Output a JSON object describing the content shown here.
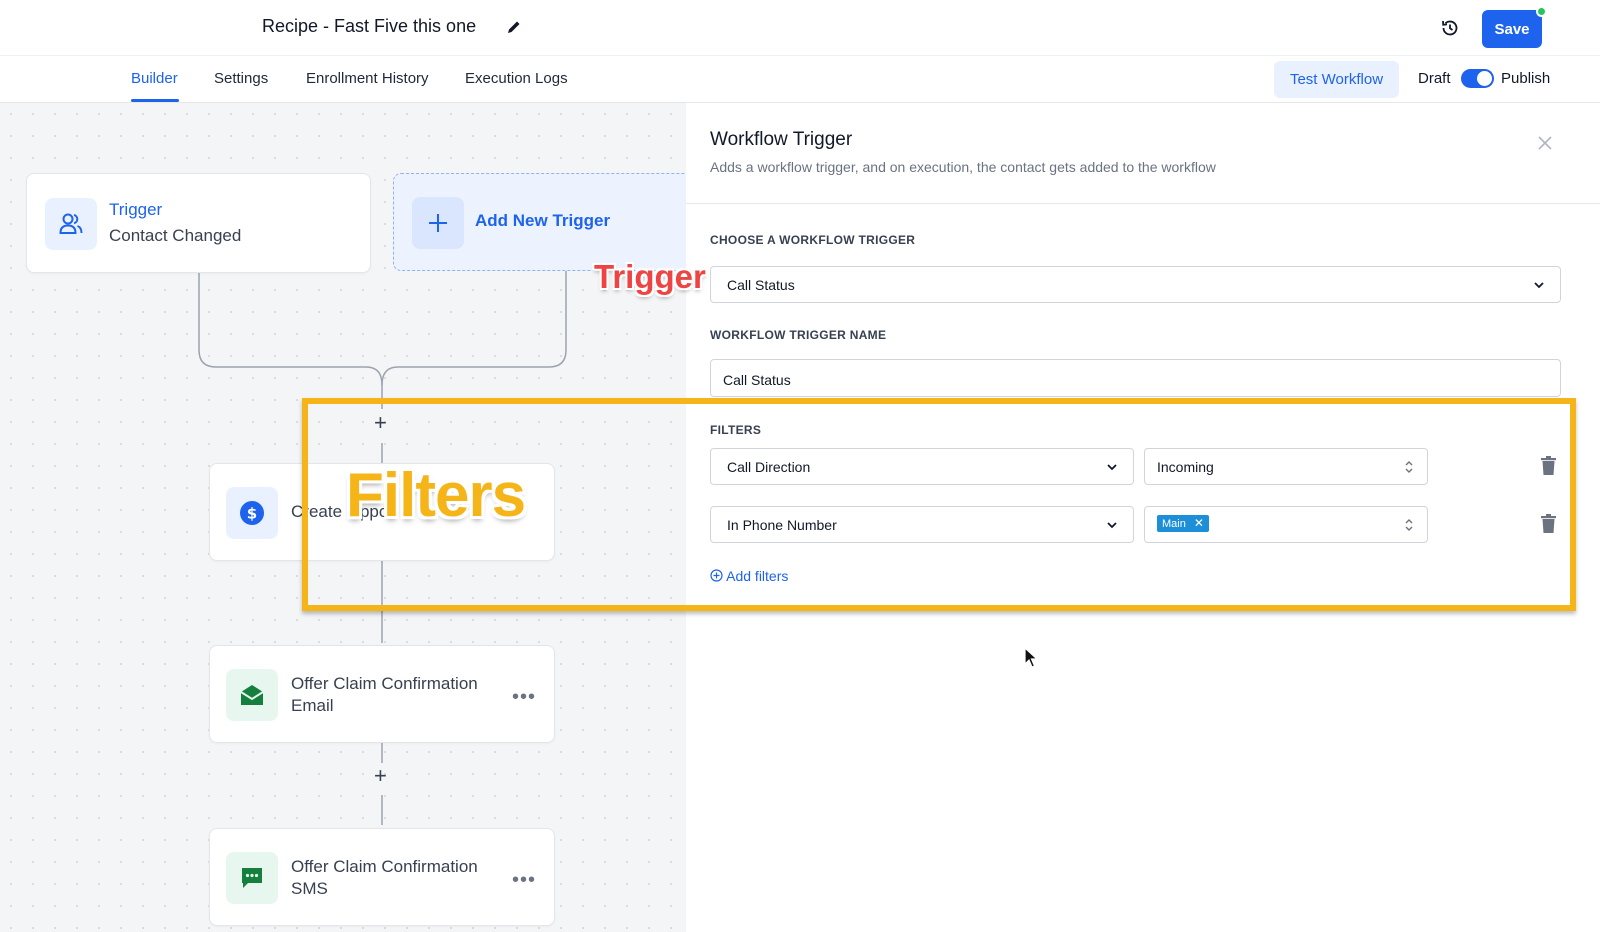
{
  "header": {
    "title": "Recipe - Fast Five this one",
    "save_label": "Save"
  },
  "tabs": [
    {
      "label": "Builder",
      "active": true
    },
    {
      "label": "Settings"
    },
    {
      "label": "Enrollment History"
    },
    {
      "label": "Execution Logs"
    }
  ],
  "toolbar": {
    "test_workflow": "Test Workflow",
    "draft": "Draft",
    "publish": "Publish",
    "published_toggle": true
  },
  "canvas": {
    "trigger": {
      "title": "Trigger",
      "subtitle": "Contact Changed"
    },
    "add_trigger": "Add New Trigger",
    "actions": [
      {
        "label": "Create Oppo",
        "icon": "dollar-icon"
      },
      {
        "label": "Offer Claim Confirmation Email",
        "icon": "email-icon"
      },
      {
        "label": "Offer Claim Confirmation SMS",
        "icon": "sms-icon"
      }
    ]
  },
  "annotations": {
    "trigger": "Trigger",
    "filters": "Filters"
  },
  "panel": {
    "title": "Workflow Trigger",
    "subtitle": "Adds a workflow trigger, and on execution, the contact gets added to the workflow",
    "choose_label": "CHOOSE A WORKFLOW TRIGGER",
    "choose_value": "Call Status",
    "name_label": "WORKFLOW TRIGGER NAME",
    "name_value": "Call Status",
    "filters_label": "FILTERS",
    "filters": [
      {
        "field": "Call Direction",
        "value": "Incoming"
      },
      {
        "field": "In Phone Number",
        "tag": "Main"
      }
    ],
    "add_filters": "Add filters"
  },
  "colors": {
    "accent": "#1d63ed",
    "highlight": "#f5b518",
    "annotation_red": "#ef4444",
    "status_green": "#22c55e"
  }
}
